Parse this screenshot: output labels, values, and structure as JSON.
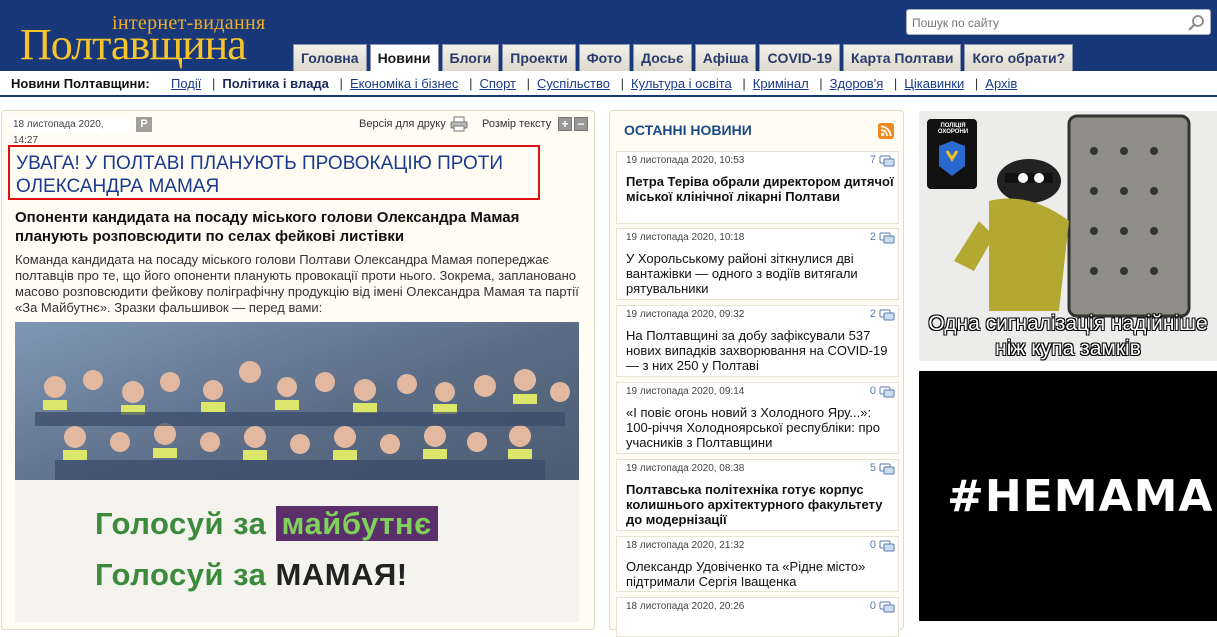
{
  "site": {
    "logo_subtitle": "інтернет-видання",
    "logo_title": "Полтавщина"
  },
  "search": {
    "placeholder": "Пошук по сайту"
  },
  "tabs": [
    {
      "label": "Головна"
    },
    {
      "label": "Новини"
    },
    {
      "label": "Блоги"
    },
    {
      "label": "Проекти"
    },
    {
      "label": "Фото"
    },
    {
      "label": "Досьє"
    },
    {
      "label": "Афіша"
    },
    {
      "label": "COVID-19"
    },
    {
      "label": "Карта Полтави"
    },
    {
      "label": "Кого обрати?"
    }
  ],
  "active_tab": "Новини",
  "subnav": {
    "label": "Новини Полтавщини:",
    "items": [
      "Події",
      "Політика і влада",
      "Економіка і бізнес",
      "Спорт",
      "Суспільство",
      "Культура і освіта",
      "Кримінал",
      "Здоров'я",
      "Цікавинки",
      "Архів"
    ],
    "current": "Політика і влада"
  },
  "article": {
    "date": "18 листопада 2020, 14:27",
    "badge": "P",
    "print_label": "Версія для друку",
    "font_size_label": "Розмір тексту",
    "plus": "+",
    "minus": "−",
    "headline": "УВАГА! У ПОЛТАВІ ПЛАНУЮТЬ ПРОВОКАЦІЮ ПРОТИ ОЛЕКСАНДРА МАМАЯ",
    "lead": "Опоненти кандидата на посаду міського голови Олександра Мамая планують розповсюдити по селах фейкові листівки",
    "body": "Команда кандидата на посаду міського голови Полтави Олександра Мамая попереджає полтавців про те, що його опоненти планують провокації проти нього. Зокрема, заплановано масово розповсюдити фейкову поліграфічну продукцію від імені Олександра Мамая та партії «За Майбутнє». Зразки фальшивок — перед вами:",
    "photo_banner": {
      "line1_prefix": "Голосуй за",
      "line1_highlight": "майбутнє",
      "line2_prefix": "Голосуй за",
      "line2_bold": "МАМАЯ!"
    }
  },
  "latest_news": {
    "title": "ОСТАННІ НОВИНИ",
    "items": [
      {
        "date": "19 листопада 2020, 10:53",
        "comments": "7",
        "title": "Петра Теріва обрали директором дитячої міської клінічної лікарні Полтави",
        "bold": true
      },
      {
        "date": "19 листопада 2020, 10:18",
        "comments": "2",
        "title": "У Хорольському районі зіткнулися дві вантажівки — одного з водіїв витягали рятувальники",
        "bold": false
      },
      {
        "date": "19 листопада 2020, 09:32",
        "comments": "2",
        "title": "На Полтавщині за добу зафіксували 537 нових випадків захворювання на COVID-19 — з них 250 у Полтаві",
        "bold": false
      },
      {
        "date": "19 листопада 2020, 09:14",
        "comments": "0",
        "title": "«І повіє огонь новий з Холодного Яру...»: 100-річчя Холодноярської республіки: про учасників з Полтавщини",
        "bold": false
      },
      {
        "date": "19 листопада 2020, 08:38",
        "comments": "5",
        "title": "Полтавська політехніка готує корпус колишнього архітектурного факультету до модернізації",
        "bold": true
      },
      {
        "date": "18 листопада 2020, 21:32",
        "comments": "0",
        "title": "Олександр Удовіченко та «Рідне місто» підтримали Сергія Іващенка",
        "bold": false
      },
      {
        "date": "18 листопада 2020, 20:26",
        "comments": "0",
        "title": "",
        "bold": false
      }
    ]
  },
  "ads": {
    "ad1_badge": "ПОЛІЦІЯ ОХОРОНИ",
    "ad1_caption_1": "Одна сигналізація надійніше",
    "ad1_caption_2": "ніж купа замків",
    "ad2_text": "#НЕМАМАЙ"
  }
}
